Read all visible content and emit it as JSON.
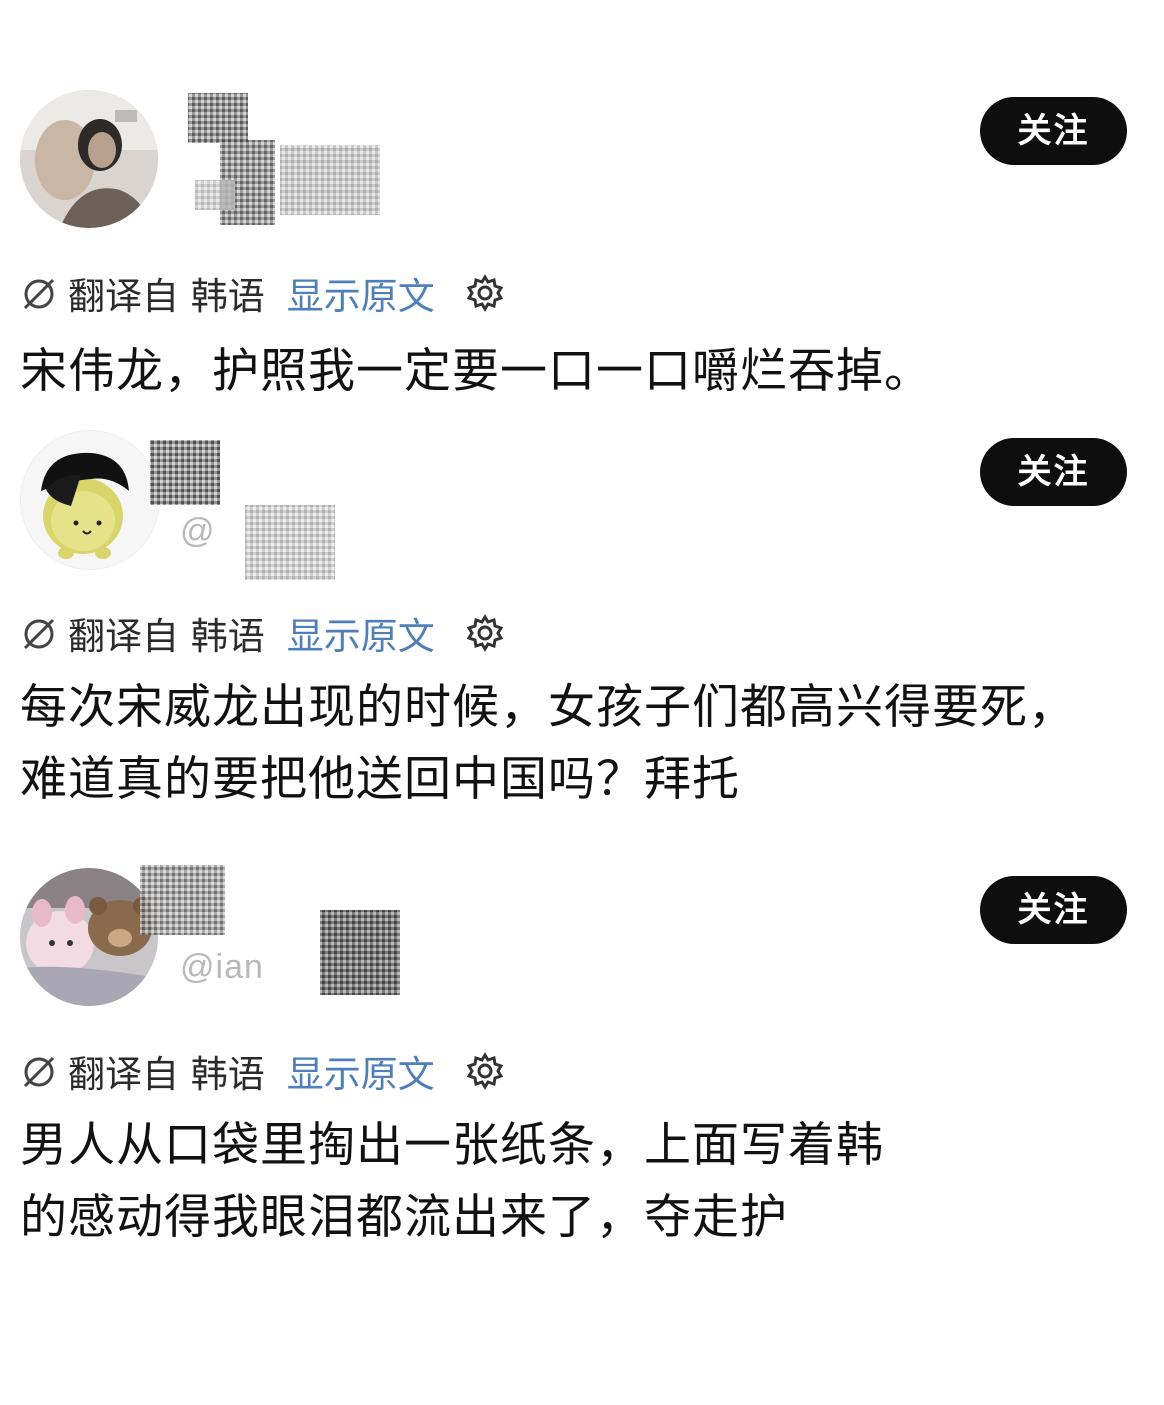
{
  "posts": [
    {
      "follow_label": "关注",
      "translated_from": "翻译自 韩语",
      "show_original": "显示原文",
      "text": "宋伟龙，护照我一定要一口一口嚼烂吞掉。"
    },
    {
      "handle": "@",
      "follow_label": "关注",
      "translated_from": "翻译自 韩语",
      "show_original": "显示原文",
      "text": "每次宋威龙出现的时候，女孩子们都高兴得要死，难道真的要把他送回中国吗？拜托"
    },
    {
      "handle": "@ian",
      "follow_label": "关注",
      "translated_from": "翻译自 韩语",
      "show_original": "显示原文",
      "text": "男人从口袋里掏出一张纸条，上面写着韩\n的感动得我眼泪都流出来了，夺走护"
    }
  ],
  "colors": {
    "follow_button_bg": "#0e0e0e",
    "follow_button_text": "#ffffff",
    "link_blue": "#4f7fb8",
    "body_text": "#111111",
    "meta_text": "#2b2b2b"
  },
  "icons": {
    "translate": "slash-circle-icon",
    "settings": "gear-icon"
  }
}
